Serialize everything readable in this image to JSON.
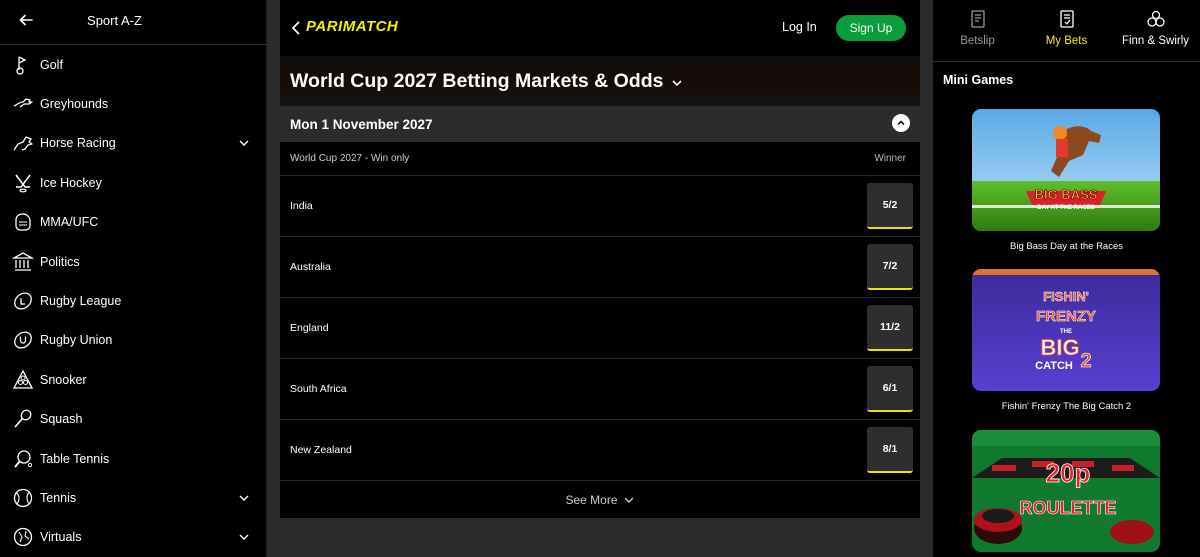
{
  "sidebar": {
    "title": "Sport A-Z",
    "items": [
      {
        "label": "Golf",
        "icon": "golf-icon",
        "expandable": false
      },
      {
        "label": "Greyhounds",
        "icon": "greyhound-icon",
        "expandable": false
      },
      {
        "label": "Horse Racing",
        "icon": "horse-racing-icon",
        "expandable": true
      },
      {
        "label": "Ice Hockey",
        "icon": "ice-hockey-icon",
        "expandable": false
      },
      {
        "label": "MMA/UFC",
        "icon": "mma-icon",
        "expandable": false
      },
      {
        "label": "Politics",
        "icon": "politics-icon",
        "expandable": false
      },
      {
        "label": "Rugby League",
        "icon": "rugby-league-icon",
        "expandable": false
      },
      {
        "label": "Rugby Union",
        "icon": "rugby-union-icon",
        "expandable": false
      },
      {
        "label": "Snooker",
        "icon": "snooker-icon",
        "expandable": false
      },
      {
        "label": "Squash",
        "icon": "squash-icon",
        "expandable": false
      },
      {
        "label": "Table Tennis",
        "icon": "table-tennis-icon",
        "expandable": false
      },
      {
        "label": "Tennis",
        "icon": "tennis-icon",
        "expandable": true
      },
      {
        "label": "Virtuals",
        "icon": "virtuals-icon",
        "expandable": true
      }
    ]
  },
  "header": {
    "brand": "PARIMATCH",
    "login_label": "Log In",
    "signup_label": "Sign Up"
  },
  "main": {
    "page_title": "World Cup 2027 Betting Markets & Odds",
    "date": "Mon 1 November 2027",
    "market_name": "World Cup 2027 - Win only",
    "market_column": "Winner",
    "runners": [
      {
        "name": "India",
        "odds": "5/2"
      },
      {
        "name": "Australia",
        "odds": "7/2"
      },
      {
        "name": "England",
        "odds": "11/2"
      },
      {
        "name": "South Africa",
        "odds": "6/1"
      },
      {
        "name": "New Zealand",
        "odds": "8/1"
      }
    ],
    "see_more_label": "See More"
  },
  "right": {
    "tabs": [
      {
        "label": "Betslip",
        "icon": "betslip-icon",
        "state": "dim"
      },
      {
        "label": "My Bets",
        "icon": "my-bets-icon",
        "state": "active"
      },
      {
        "label": "Finn & Swirly",
        "icon": "finn-swirly-icon",
        "state": "white"
      }
    ],
    "mini_games_title": "Mini Games",
    "games": [
      {
        "name": "Big Bass Day at the Races",
        "art_line1": "BIG BASS",
        "art_line2": "DAY AT THE RACES"
      },
      {
        "name": "Fishin' Frenzy The Big Catch 2",
        "art_line1": "FISHIN'",
        "art_line2": "FRENZY",
        "art_line3": "THE",
        "art_line4": "BIG",
        "art_line5": "CATCH",
        "art_line6": "2"
      },
      {
        "name": "",
        "art_line1": "20p",
        "art_line2": "ROULETTE"
      }
    ]
  },
  "colors": {
    "accent_yellow": "#f2f200",
    "signup_green": "#0a9d3c",
    "background": "#000000"
  }
}
